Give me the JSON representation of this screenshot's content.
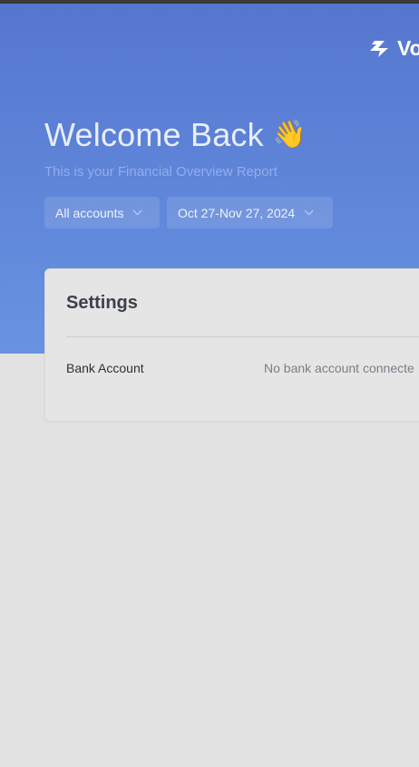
{
  "brand": {
    "name": "Vo",
    "logo_icon": "lightning-bolt-icon"
  },
  "header": {
    "title": "Welcome Back",
    "wave_emoji": "👋",
    "subtitle": "This is your Financial Overview Report"
  },
  "filters": {
    "accounts_label": "All accounts",
    "date_range_label": "Oct 27-Nov 27, 2024"
  },
  "settings": {
    "title": "Settings",
    "bank_account_label": "Bank Account",
    "bank_account_value": "No bank account connecte"
  },
  "colors": {
    "hero_top": "#5676cf",
    "hero_bottom": "#6993e2",
    "page_background": "#e2e2e2"
  }
}
